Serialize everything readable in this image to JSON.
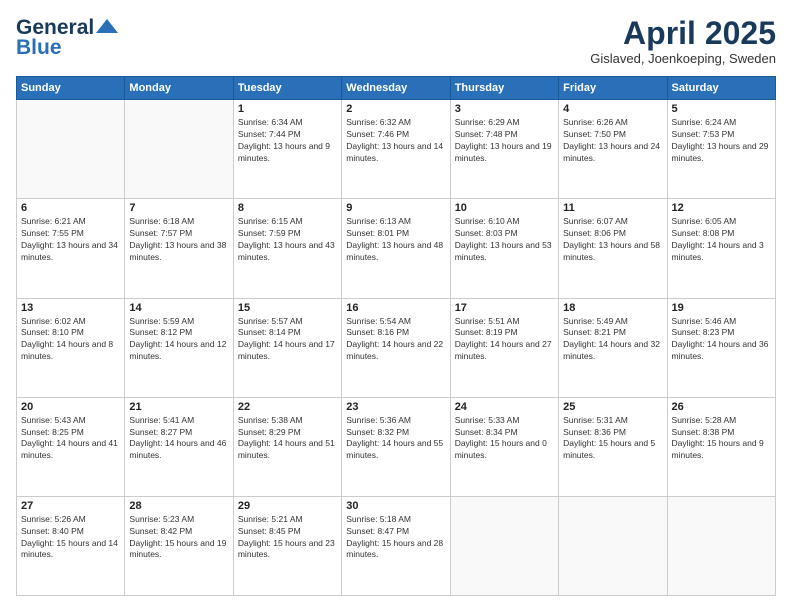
{
  "header": {
    "logo_general": "General",
    "logo_blue": "Blue",
    "month_title": "April 2025",
    "location": "Gislaved, Joenkoeping, Sweden"
  },
  "days_of_week": [
    "Sunday",
    "Monday",
    "Tuesday",
    "Wednesday",
    "Thursday",
    "Friday",
    "Saturday"
  ],
  "weeks": [
    [
      {
        "day": "",
        "sunrise": "",
        "sunset": "",
        "daylight": ""
      },
      {
        "day": "",
        "sunrise": "",
        "sunset": "",
        "daylight": ""
      },
      {
        "day": "1",
        "sunrise": "Sunrise: 6:34 AM",
        "sunset": "Sunset: 7:44 PM",
        "daylight": "Daylight: 13 hours and 9 minutes."
      },
      {
        "day": "2",
        "sunrise": "Sunrise: 6:32 AM",
        "sunset": "Sunset: 7:46 PM",
        "daylight": "Daylight: 13 hours and 14 minutes."
      },
      {
        "day": "3",
        "sunrise": "Sunrise: 6:29 AM",
        "sunset": "Sunset: 7:48 PM",
        "daylight": "Daylight: 13 hours and 19 minutes."
      },
      {
        "day": "4",
        "sunrise": "Sunrise: 6:26 AM",
        "sunset": "Sunset: 7:50 PM",
        "daylight": "Daylight: 13 hours and 24 minutes."
      },
      {
        "day": "5",
        "sunrise": "Sunrise: 6:24 AM",
        "sunset": "Sunset: 7:53 PM",
        "daylight": "Daylight: 13 hours and 29 minutes."
      }
    ],
    [
      {
        "day": "6",
        "sunrise": "Sunrise: 6:21 AM",
        "sunset": "Sunset: 7:55 PM",
        "daylight": "Daylight: 13 hours and 34 minutes."
      },
      {
        "day": "7",
        "sunrise": "Sunrise: 6:18 AM",
        "sunset": "Sunset: 7:57 PM",
        "daylight": "Daylight: 13 hours and 38 minutes."
      },
      {
        "day": "8",
        "sunrise": "Sunrise: 6:15 AM",
        "sunset": "Sunset: 7:59 PM",
        "daylight": "Daylight: 13 hours and 43 minutes."
      },
      {
        "day": "9",
        "sunrise": "Sunrise: 6:13 AM",
        "sunset": "Sunset: 8:01 PM",
        "daylight": "Daylight: 13 hours and 48 minutes."
      },
      {
        "day": "10",
        "sunrise": "Sunrise: 6:10 AM",
        "sunset": "Sunset: 8:03 PM",
        "daylight": "Daylight: 13 hours and 53 minutes."
      },
      {
        "day": "11",
        "sunrise": "Sunrise: 6:07 AM",
        "sunset": "Sunset: 8:06 PM",
        "daylight": "Daylight: 13 hours and 58 minutes."
      },
      {
        "day": "12",
        "sunrise": "Sunrise: 6:05 AM",
        "sunset": "Sunset: 8:08 PM",
        "daylight": "Daylight: 14 hours and 3 minutes."
      }
    ],
    [
      {
        "day": "13",
        "sunrise": "Sunrise: 6:02 AM",
        "sunset": "Sunset: 8:10 PM",
        "daylight": "Daylight: 14 hours and 8 minutes."
      },
      {
        "day": "14",
        "sunrise": "Sunrise: 5:59 AM",
        "sunset": "Sunset: 8:12 PM",
        "daylight": "Daylight: 14 hours and 12 minutes."
      },
      {
        "day": "15",
        "sunrise": "Sunrise: 5:57 AM",
        "sunset": "Sunset: 8:14 PM",
        "daylight": "Daylight: 14 hours and 17 minutes."
      },
      {
        "day": "16",
        "sunrise": "Sunrise: 5:54 AM",
        "sunset": "Sunset: 8:16 PM",
        "daylight": "Daylight: 14 hours and 22 minutes."
      },
      {
        "day": "17",
        "sunrise": "Sunrise: 5:51 AM",
        "sunset": "Sunset: 8:19 PM",
        "daylight": "Daylight: 14 hours and 27 minutes."
      },
      {
        "day": "18",
        "sunrise": "Sunrise: 5:49 AM",
        "sunset": "Sunset: 8:21 PM",
        "daylight": "Daylight: 14 hours and 32 minutes."
      },
      {
        "day": "19",
        "sunrise": "Sunrise: 5:46 AM",
        "sunset": "Sunset: 8:23 PM",
        "daylight": "Daylight: 14 hours and 36 minutes."
      }
    ],
    [
      {
        "day": "20",
        "sunrise": "Sunrise: 5:43 AM",
        "sunset": "Sunset: 8:25 PM",
        "daylight": "Daylight: 14 hours and 41 minutes."
      },
      {
        "day": "21",
        "sunrise": "Sunrise: 5:41 AM",
        "sunset": "Sunset: 8:27 PM",
        "daylight": "Daylight: 14 hours and 46 minutes."
      },
      {
        "day": "22",
        "sunrise": "Sunrise: 5:38 AM",
        "sunset": "Sunset: 8:29 PM",
        "daylight": "Daylight: 14 hours and 51 minutes."
      },
      {
        "day": "23",
        "sunrise": "Sunrise: 5:36 AM",
        "sunset": "Sunset: 8:32 PM",
        "daylight": "Daylight: 14 hours and 55 minutes."
      },
      {
        "day": "24",
        "sunrise": "Sunrise: 5:33 AM",
        "sunset": "Sunset: 8:34 PM",
        "daylight": "Daylight: 15 hours and 0 minutes."
      },
      {
        "day": "25",
        "sunrise": "Sunrise: 5:31 AM",
        "sunset": "Sunset: 8:36 PM",
        "daylight": "Daylight: 15 hours and 5 minutes."
      },
      {
        "day": "26",
        "sunrise": "Sunrise: 5:28 AM",
        "sunset": "Sunset: 8:38 PM",
        "daylight": "Daylight: 15 hours and 9 minutes."
      }
    ],
    [
      {
        "day": "27",
        "sunrise": "Sunrise: 5:26 AM",
        "sunset": "Sunset: 8:40 PM",
        "daylight": "Daylight: 15 hours and 14 minutes."
      },
      {
        "day": "28",
        "sunrise": "Sunrise: 5:23 AM",
        "sunset": "Sunset: 8:42 PM",
        "daylight": "Daylight: 15 hours and 19 minutes."
      },
      {
        "day": "29",
        "sunrise": "Sunrise: 5:21 AM",
        "sunset": "Sunset: 8:45 PM",
        "daylight": "Daylight: 15 hours and 23 minutes."
      },
      {
        "day": "30",
        "sunrise": "Sunrise: 5:18 AM",
        "sunset": "Sunset: 8:47 PM",
        "daylight": "Daylight: 15 hours and 28 minutes."
      },
      {
        "day": "",
        "sunrise": "",
        "sunset": "",
        "daylight": ""
      },
      {
        "day": "",
        "sunrise": "",
        "sunset": "",
        "daylight": ""
      },
      {
        "day": "",
        "sunrise": "",
        "sunset": "",
        "daylight": ""
      }
    ]
  ]
}
